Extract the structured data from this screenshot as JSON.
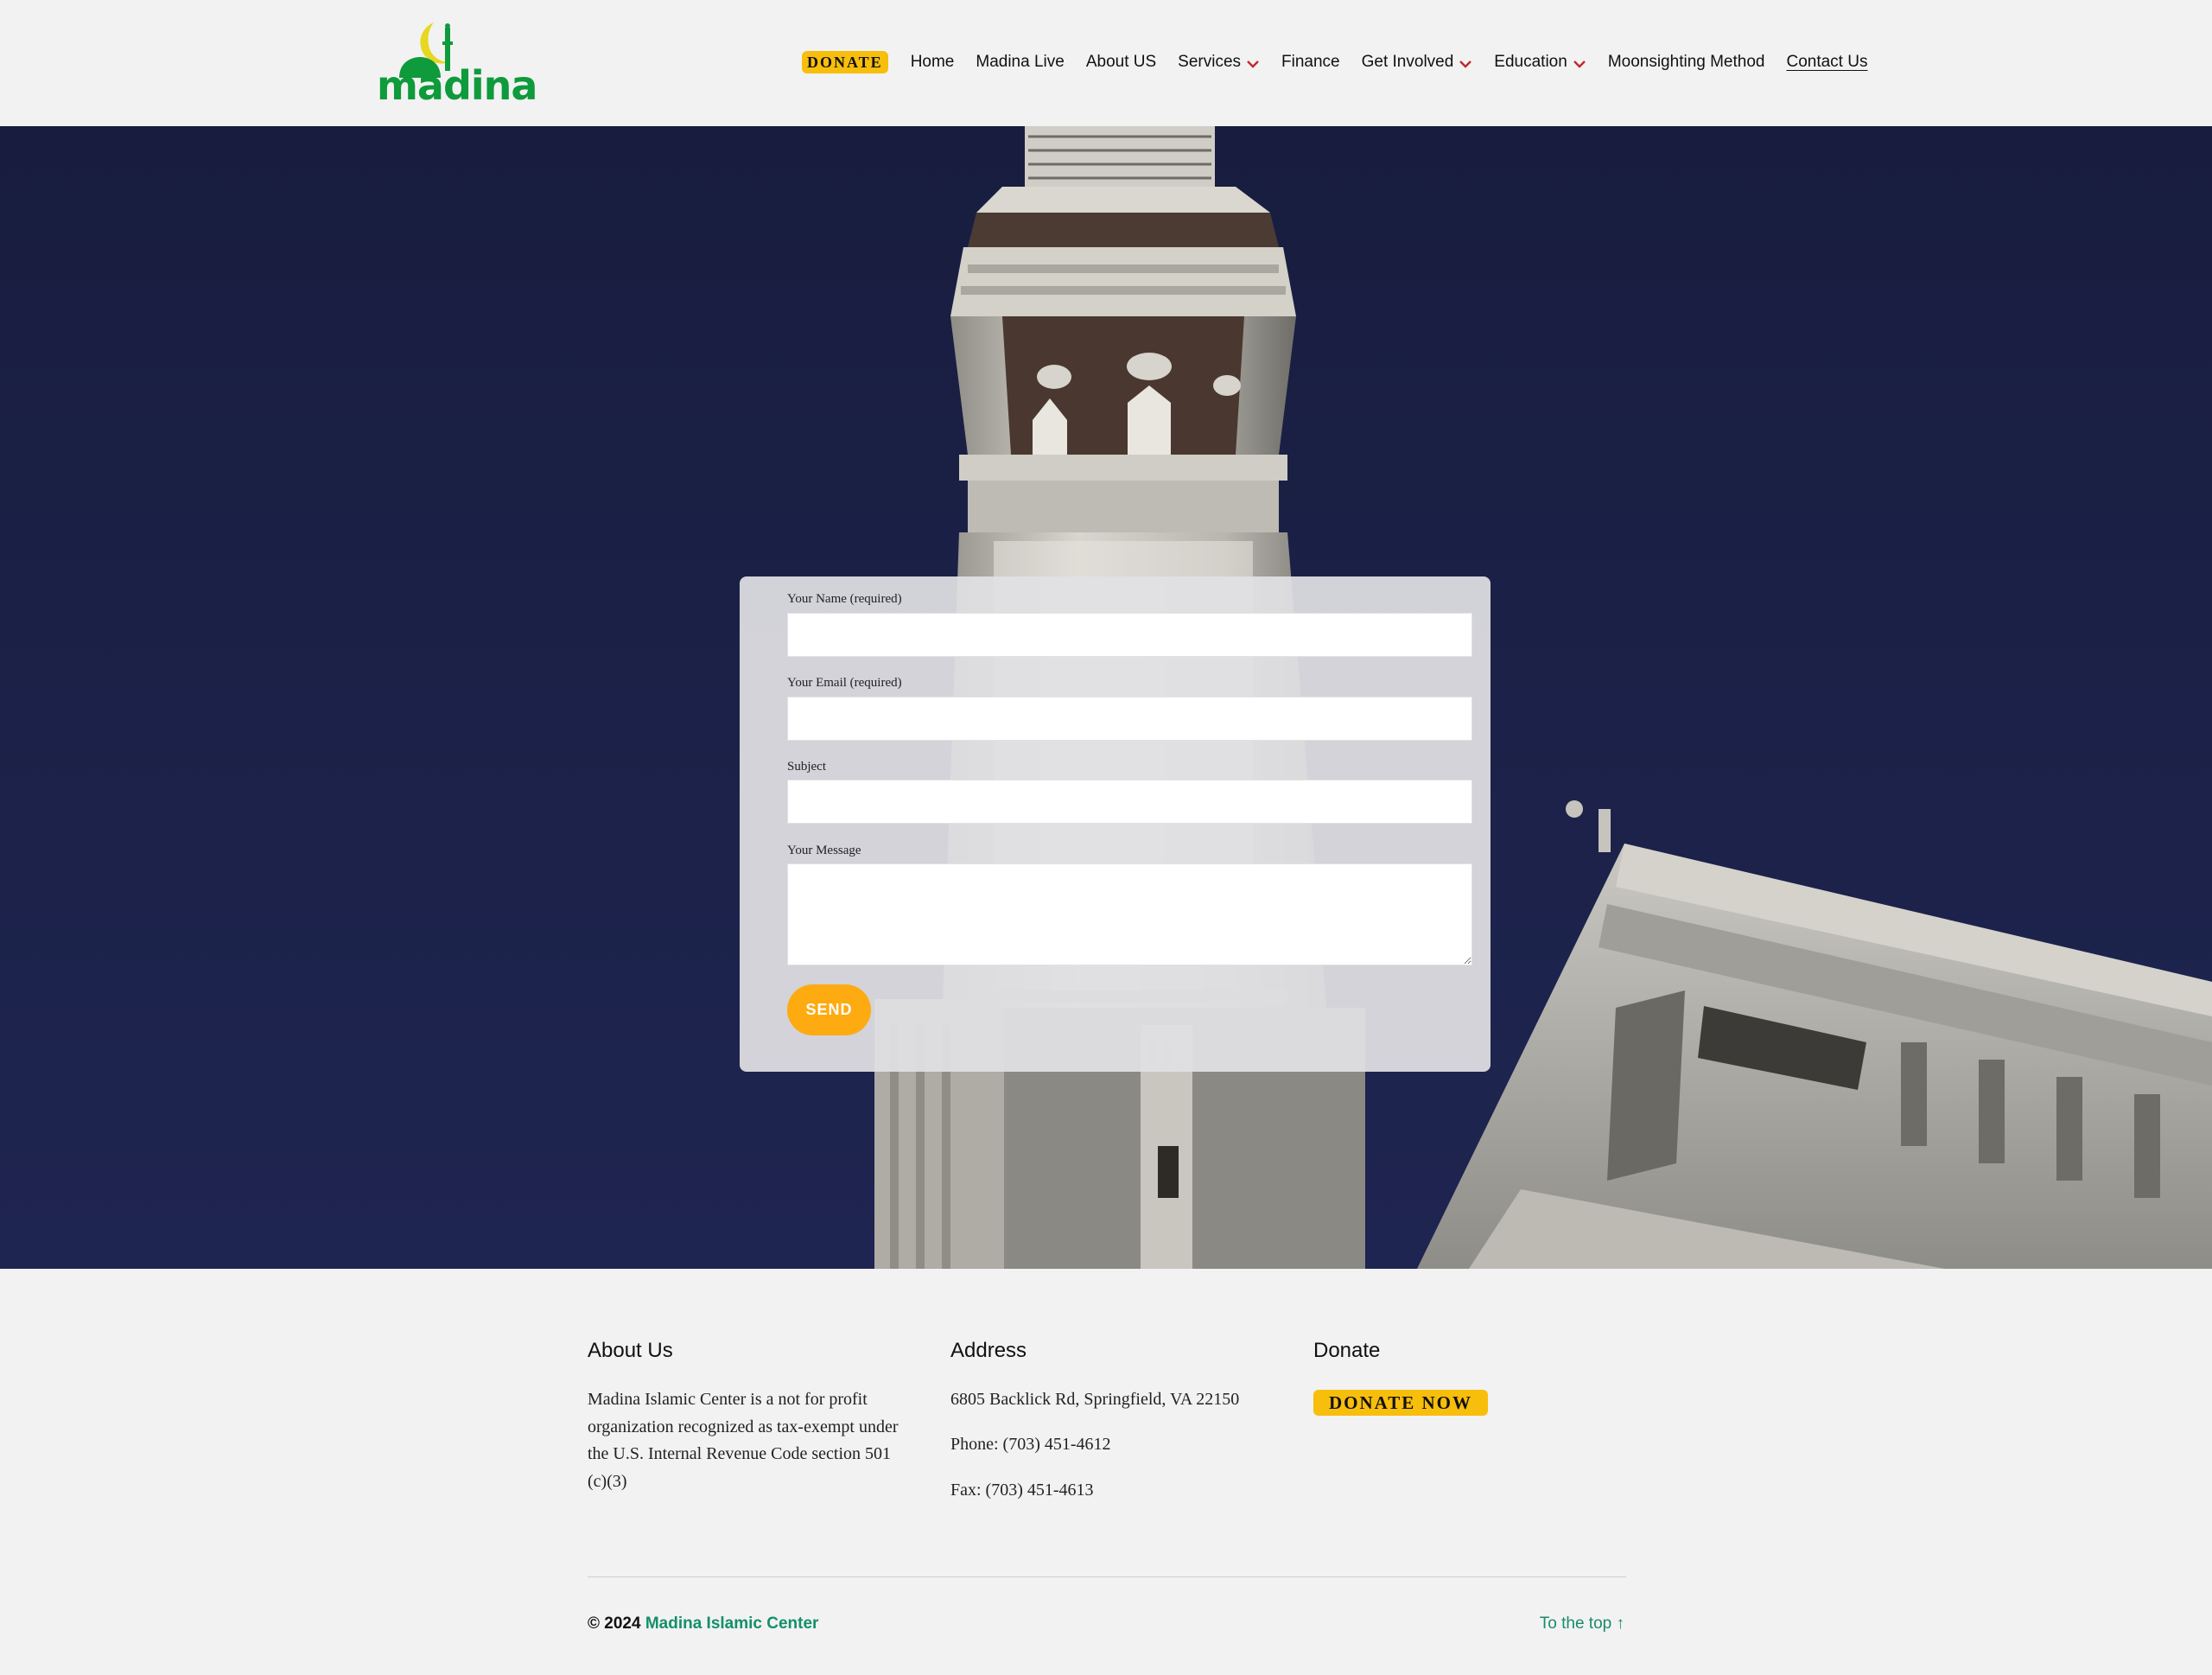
{
  "header": {
    "logo_text": "madina",
    "nav": {
      "donate": "DONATE",
      "home": "Home",
      "madina_live": "Madina Live",
      "about": "About US",
      "services": "Services",
      "finance": "Finance",
      "get_involved": "Get Involved",
      "education": "Education",
      "moonsighting": "Moonsighting Method",
      "contact": "Contact Us"
    }
  },
  "form": {
    "name_label": "Your Name (required)",
    "email_label": "Your Email (required)",
    "subject_label": "Subject",
    "message_label": "Your Message",
    "name_value": "",
    "email_value": "",
    "subject_value": "",
    "message_value": "",
    "send_label": "SEND"
  },
  "footer": {
    "about": {
      "heading": "About Us",
      "text": "Madina Islamic Center is a not for profit organization recognized as tax-exempt under the U.S. Internal Revenue Code section 501 (c)(3)"
    },
    "address": {
      "heading": "Address",
      "street": "6805 Backlick Rd, Springfield, VA 22150",
      "phone": "Phone: (703) 451-4612",
      "fax": "Fax: (703) 451-4613"
    },
    "donate": {
      "heading": "Donate",
      "button": "DONATE NOW"
    },
    "copyright_prefix": "© 2024",
    "org_name": "Madina Islamic Center",
    "to_top": "To the top ↑"
  },
  "colors": {
    "brand_green": "#0f9a3c",
    "logo_yellow": "#e6d81e",
    "donate_yellow": "#f7be0b",
    "send_orange": "#fdab10",
    "chevron_red": "#c0282b",
    "hero_sky": "#1b2145",
    "footer_link": "#138f6a"
  },
  "icons": {
    "chevron": "chevron-down-icon",
    "logo": "crescent-minaret-dome-icon"
  }
}
